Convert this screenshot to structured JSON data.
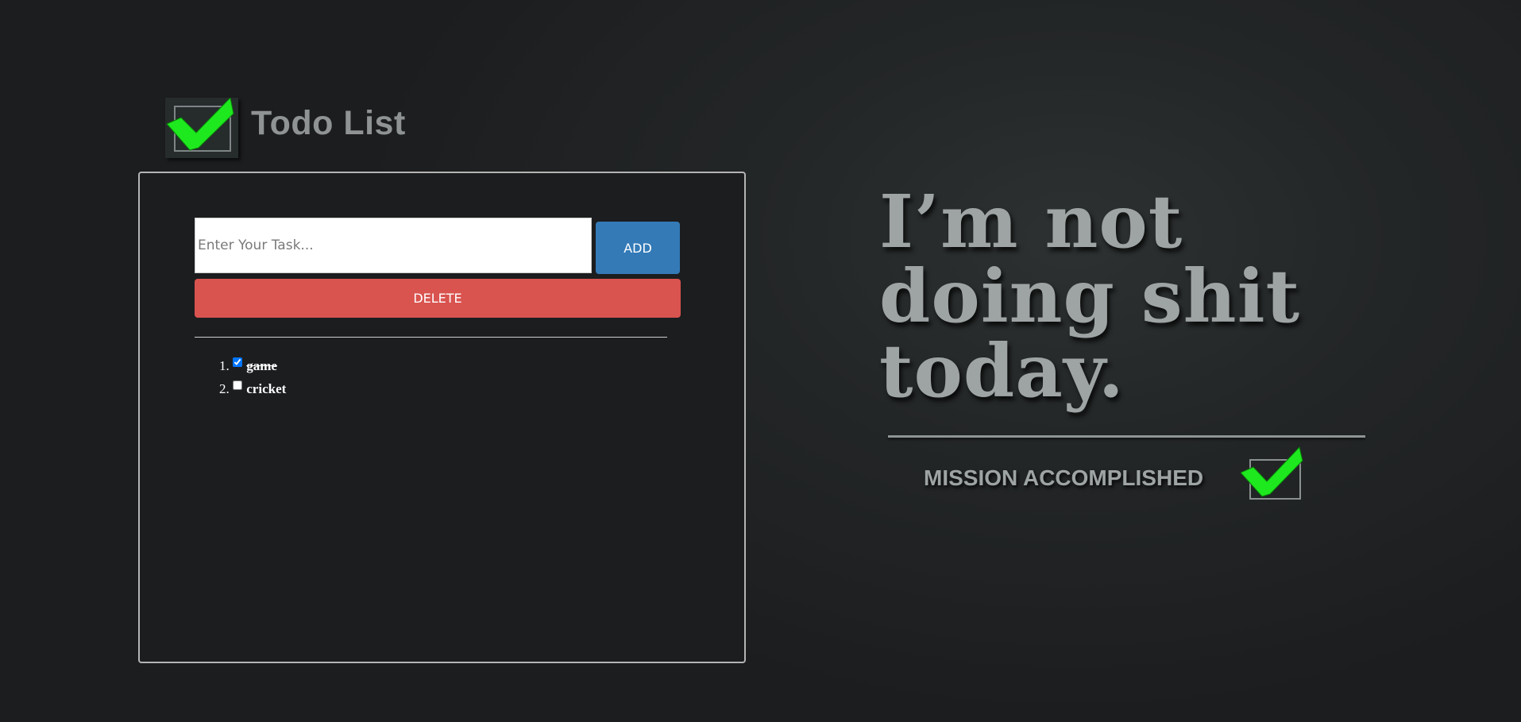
{
  "header": {
    "title": "Todo List",
    "logo_icon": "checkbox-check-icon"
  },
  "form": {
    "input_placeholder": "Enter Your Task...",
    "input_value": "",
    "add_label": "ADD",
    "delete_label": "DELETE"
  },
  "tasks": [
    {
      "index": "1.",
      "text": "game",
      "checked": true
    },
    {
      "index": "2.",
      "text": "cricket",
      "checked": false
    }
  ],
  "wallpaper": {
    "quote_lines": [
      "I’m not",
      "doing shit",
      "today."
    ],
    "caption": "MISSION ACCOMPLISHED",
    "caption_icon": "checkbox-check-icon"
  },
  "colors": {
    "add_button": "#337ab7",
    "delete_button": "#d9534f",
    "check_green": "#1ee81e",
    "title_gray": "#8f9393"
  }
}
